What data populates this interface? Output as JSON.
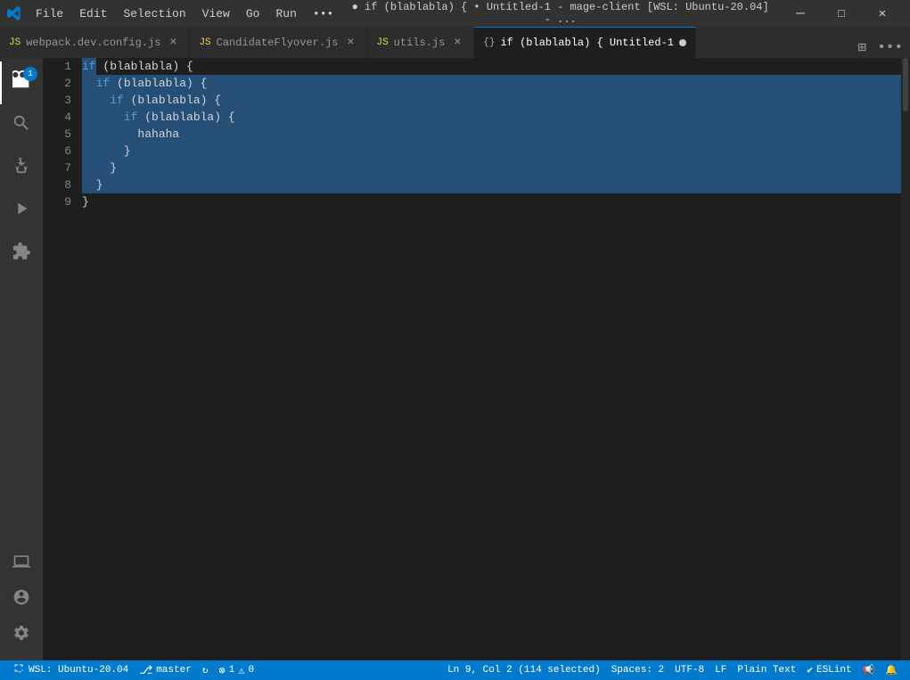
{
  "titlebar": {
    "menu": [
      "File",
      "Edit",
      "Selection",
      "View",
      "Go",
      "Run",
      "•••"
    ],
    "title": "● if (blablabla) { • Untitled-1 - mage-client [WSL: Ubuntu-20.04] - ...",
    "minimize": "—",
    "maximize": "□",
    "close": "✕"
  },
  "tabs": [
    {
      "id": "webpack",
      "icon": "JS",
      "label": "webpack.dev.config.js",
      "active": false,
      "dirty": false
    },
    {
      "id": "candidateflyover",
      "icon": "JS",
      "label": "CandidateFlyover.js",
      "active": false,
      "dirty": false
    },
    {
      "id": "utils",
      "icon": "JS",
      "label": "utils.js",
      "active": false,
      "dirty": false
    },
    {
      "id": "untitled",
      "icon": "{}",
      "label": "if (blablabla) { Untitled-1",
      "active": true,
      "dirty": true
    }
  ],
  "tab_actions": {
    "split_icon": "⊞",
    "more_icon": "•••"
  },
  "activity_bar": {
    "items": [
      {
        "id": "explorer",
        "icon": "🗂",
        "label": "Explorer",
        "badge": "1",
        "active": true
      },
      {
        "id": "search",
        "icon": "🔍",
        "label": "Search",
        "active": false
      },
      {
        "id": "scm",
        "icon": "⑂",
        "label": "Source Control",
        "active": false
      },
      {
        "id": "run",
        "icon": "▶",
        "label": "Run and Debug",
        "active": false
      },
      {
        "id": "extensions",
        "icon": "⊞",
        "label": "Extensions",
        "active": false
      }
    ],
    "bottom": [
      {
        "id": "remote",
        "icon": "🖥",
        "label": "Remote Explorer"
      },
      {
        "id": "account",
        "icon": "👤",
        "label": "Account"
      },
      {
        "id": "settings",
        "icon": "⚙",
        "label": "Settings"
      }
    ]
  },
  "editor": {
    "lines": [
      {
        "num": 1,
        "indent": 0,
        "text": "if (blablabla) {",
        "selected": false
      },
      {
        "num": 2,
        "indent": 1,
        "text": "  if (blablabla) {",
        "selected": true
      },
      {
        "num": 3,
        "indent": 2,
        "text": "    if (blablabla) {",
        "selected": true
      },
      {
        "num": 4,
        "indent": 3,
        "text": "      if (blablabla) {",
        "selected": true
      },
      {
        "num": 5,
        "indent": 4,
        "text": "        hahaha",
        "selected": true
      },
      {
        "num": 6,
        "indent": 3,
        "text": "      }",
        "selected": true
      },
      {
        "num": 7,
        "indent": 2,
        "text": "    }",
        "selected": true
      },
      {
        "num": 8,
        "indent": 1,
        "text": "  }",
        "selected": true
      },
      {
        "num": 9,
        "indent": 0,
        "text": "}",
        "selected": false
      }
    ]
  },
  "statusbar": {
    "wsl": "WSL: Ubuntu-20.04",
    "branch_icon": "⎇",
    "branch": "master",
    "sync_icon": "↻",
    "errors": "1",
    "warnings": "0",
    "position": "Ln 9, Col 2 (114 selected)",
    "spaces": "Spaces: 2",
    "encoding": "UTF-8",
    "eol": "LF",
    "language": "Plain Text",
    "eslint_icon": "✔",
    "eslint": "ESLint",
    "bell_icon": "🔔",
    "broadcast_icon": "📢"
  }
}
